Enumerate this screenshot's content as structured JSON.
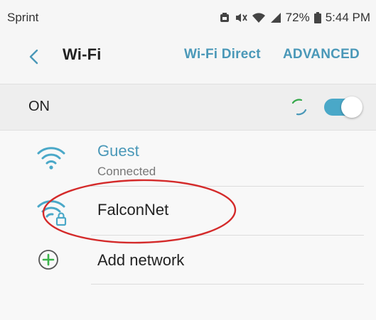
{
  "status_bar": {
    "carrier": "Sprint",
    "battery": "72%",
    "time": "5:44 PM"
  },
  "header": {
    "title": "Wi-Fi",
    "actions": [
      "Wi-Fi Direct",
      "ADVANCED"
    ]
  },
  "wifi_toggle": {
    "label": "ON",
    "state": true
  },
  "networks": [
    {
      "name": "Guest",
      "status": "Connected",
      "secured": false
    },
    {
      "name": "FalconNet",
      "secured": true
    }
  ],
  "add_network": {
    "label": "Add network"
  },
  "colors": {
    "accent": "#4a98b8",
    "toggle": "#4aa8c8",
    "add_icon": "#3bb34a",
    "annotation": "#d42a2a"
  },
  "icons": {
    "back": "back-arrow-icon",
    "wifi": "wifi-icon",
    "wifi_secured": "wifi-lock-icon",
    "add": "plus-circle-icon",
    "battery": "battery-icon"
  }
}
